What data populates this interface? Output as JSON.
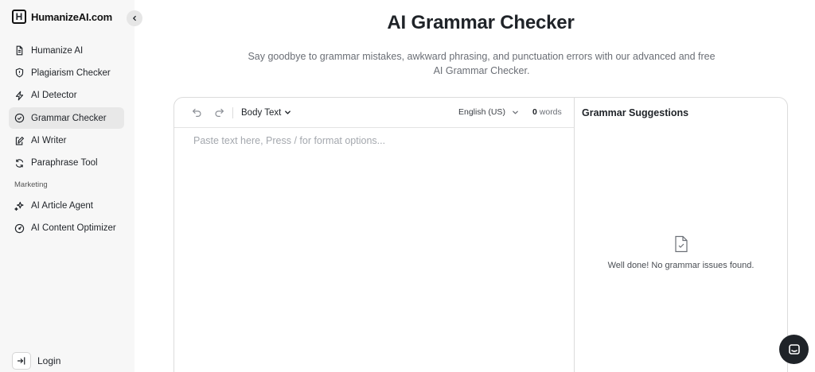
{
  "brand": {
    "logo_letter": "H",
    "name": "HumanizeAI.com"
  },
  "sidebar": {
    "items": [
      {
        "label": "Humanize AI",
        "icon": "document-icon"
      },
      {
        "label": "Plagiarism Checker",
        "icon": "shield-icon"
      },
      {
        "label": "AI Detector",
        "icon": "lightning-icon"
      },
      {
        "label": "Grammar Checker",
        "icon": "check-circle-icon",
        "active": true
      },
      {
        "label": "AI Writer",
        "icon": "pen-note-icon"
      },
      {
        "label": "Paraphrase Tool",
        "icon": "refresh-icon"
      }
    ],
    "section_label": "Marketing",
    "marketing_items": [
      {
        "label": "AI Article Agent",
        "icon": "sparkle-icon"
      },
      {
        "label": "AI Content Optimizer",
        "icon": "gauge-icon"
      }
    ],
    "login_label": "Login"
  },
  "header": {
    "title": "AI Grammar Checker",
    "subtitle": "Say goodbye to grammar mistakes, awkward phrasing, and punctuation errors with our advanced and free AI Grammar Checker."
  },
  "editor": {
    "format_label": "Body Text",
    "language": "English (US)",
    "word_count": "0",
    "words_label": "words",
    "placeholder": "Paste text here, Press / for format options..."
  },
  "suggestions": {
    "title": "Grammar Suggestions",
    "empty_message": "Well done! No grammar issues found."
  },
  "colors": {
    "active_bg": "#e8e8e8",
    "sidebar_bg": "#f7f7f7",
    "text": "#1f2328",
    "chat_button": "#1f2328"
  }
}
